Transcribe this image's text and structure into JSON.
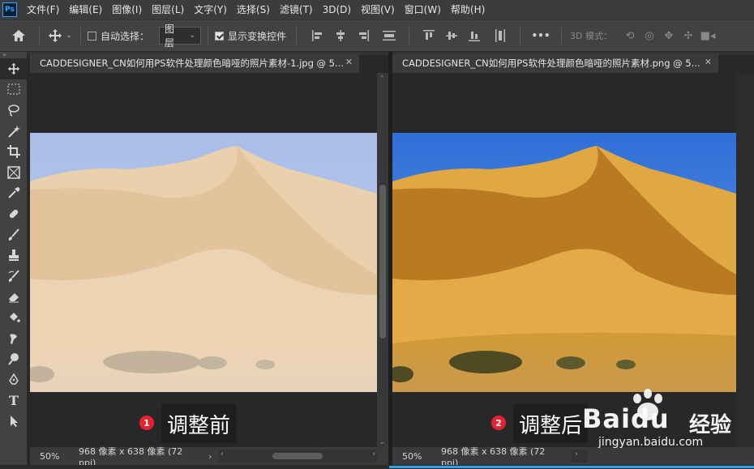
{
  "app": {
    "logo": "Ps"
  },
  "menu": [
    "文件(F)",
    "编辑(E)",
    "图像(I)",
    "图层(L)",
    "文字(Y)",
    "选择(S)",
    "滤镜(T)",
    "3D(D)",
    "视图(V)",
    "窗口(W)",
    "帮助(H)"
  ],
  "options": {
    "auto_select_label": "自动选择：",
    "auto_select_checked": false,
    "layer_select_value": "图层",
    "show_transform_label": "显示变换控件",
    "show_transform_checked": true,
    "mode_3d_label": "3D 模式：",
    "more": "•••"
  },
  "documents": [
    {
      "tab_title": "CADDESIGNER_CN如何用PS软件处理颜色暗哑的照片素材-1.jpg @ 5...",
      "zoom": "50%",
      "info": "968 像素 x 638 像素 (72 ppi)",
      "label": "调整前",
      "badge": "1"
    },
    {
      "tab_title": "CADDESIGNER_CN如何用PS软件处理颜色暗哑的照片素材.png @ 5...",
      "zoom": "50%",
      "info": "968 像素 x 638 像素 (72 ppi)",
      "label": "调整后",
      "badge": "2"
    }
  ],
  "watermark": {
    "brand": "Baidu",
    "cn": "经验",
    "url": "jingyan.baidu.com"
  },
  "colors": {
    "accent": "#31a8ff",
    "badge": "#e8212e",
    "status_blue": "#3aa0e8"
  },
  "tools": [
    "move-icon",
    "marquee-icon",
    "lasso-icon",
    "magic-wand-icon",
    "crop-icon",
    "frame-icon",
    "eyedropper-icon",
    "healing-brush-icon",
    "brush-icon",
    "clone-stamp-icon",
    "history-brush-icon",
    "eraser-icon",
    "paint-bucket-icon",
    "smudge-icon",
    "dodge-icon",
    "pen-icon",
    "type-icon",
    "path-selection-icon"
  ]
}
